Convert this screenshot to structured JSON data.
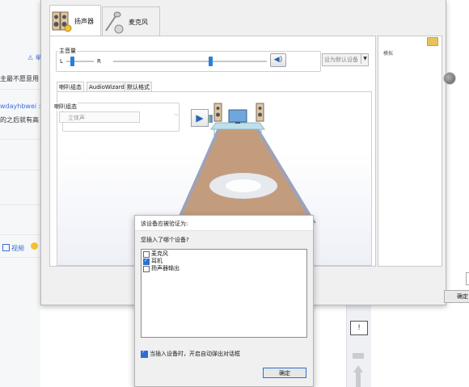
{
  "background_page": {
    "warn_text": "⚠ 举",
    "line1": "主最不愿意用",
    "user_text": "wdayhbwei :",
    "line3": "的之后就有高",
    "video_label": "视频"
  },
  "sound_window": {
    "tabs": [
      {
        "label": "扬声器"
      },
      {
        "label": "麦克风"
      }
    ],
    "master_volume": {
      "title": "主音量",
      "left_label": "L",
      "right_label": "R",
      "balance_fraction": 0.15,
      "level_fraction": 0.62
    },
    "default_device_label": "设为默认设备",
    "sub_tabs": [
      {
        "label": "喇叭组态"
      },
      {
        "label": "AudioWizard"
      },
      {
        "label": "默认格式"
      }
    ],
    "speaker_config": {
      "group_title": "喇叭组态",
      "selected": "立体声"
    },
    "right_panel_label": "模拟",
    "ok_label": "确定"
  },
  "device_dialog": {
    "title": "该设备应被验证为:",
    "question": "您插入了哪个设备?",
    "devices": [
      {
        "label": "麦克风",
        "checked": false
      },
      {
        "label": "耳机",
        "checked": true
      },
      {
        "label": "扬声器输出",
        "checked": false
      }
    ],
    "auto_popup_label": "当插入设备时，开启自动弹出对话框",
    "auto_popup_checked": true,
    "ok_label": "确定"
  },
  "colors": {
    "accent": "#2c7fd4",
    "floor": "#c39c7e",
    "floor_border": "#8b8fa8",
    "table": "#bfe0ea"
  }
}
